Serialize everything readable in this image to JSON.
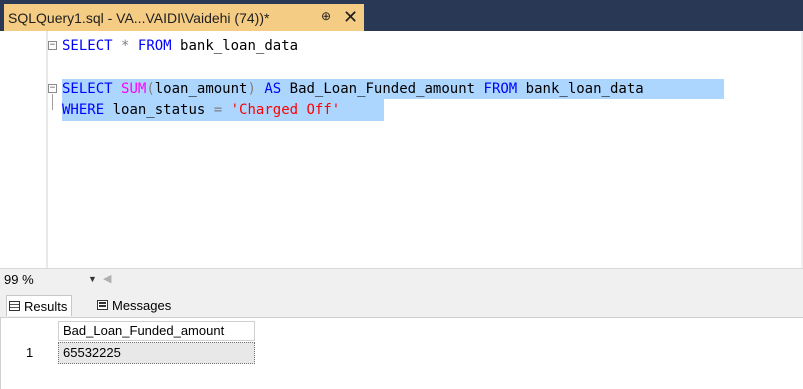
{
  "tab": {
    "title": "SQLQuery1.sql - VA...VAIDI\\Vaidehi (74))*",
    "pin_glyph": "⊕",
    "close_glyph": "✕"
  },
  "editor": {
    "line1": {
      "kw_select": "SELECT",
      "star": "*",
      "kw_from": "FROM",
      "table": "bank_loan_data"
    },
    "line3": {
      "kw_select": "SELECT",
      "fn_sum": "SUM",
      "paren_open": "(",
      "column": "loan_amount",
      "paren_close": ")",
      "kw_as": "AS",
      "alias": "Bad_Loan_Funded_amount",
      "kw_from": "FROM",
      "table": "bank_loan_data"
    },
    "line4": {
      "kw_where": "WHERE",
      "column": "loan_status",
      "op_eq": "=",
      "value": "'Charged Off'"
    },
    "fold_glyph": "−"
  },
  "zoom": {
    "value": "99 %",
    "arrow": "▼",
    "scroll_left": "◀"
  },
  "results_tabs": {
    "results_label": "Results",
    "messages_label": "Messages"
  },
  "grid": {
    "columns": [
      "Bad_Loan_Funded_amount"
    ],
    "rows": [
      {
        "row_number": "1",
        "values": [
          "65532225"
        ]
      }
    ]
  },
  "colors": {
    "tab_bar": "#293955",
    "active_tab": "#f5cc84",
    "keyword": "#0000ff",
    "function": "#ff00ff",
    "operator": "#808080",
    "string": "#ff0000",
    "selection": "#add6ff"
  }
}
